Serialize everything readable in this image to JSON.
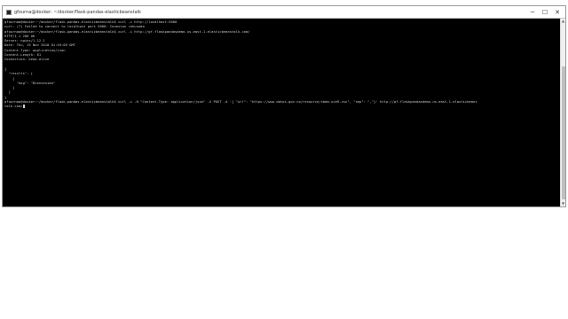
{
  "window": {
    "title": "gfourna@docker: ~/docker/flask-pandas-elasticbeanstalk",
    "controls": {
      "minimize": "─",
      "maximize": "☐",
      "close": "✕"
    }
  },
  "terminal": {
    "lines": [
      "gfournaa@docker:~/docker/flask-pandas-elasticbeanstalk$ curl -i http://localhost:5000",
      "curl: (7) Failed to connect to localhost port 5000: Conexion rehusada",
      "gfournaa@docker:~/docker/flask-pandas-elasticbeanstalk$ curl -i http://gf-flaskpandasdemo.us-east-1.elasticbeanstalk.com/",
      "HTTP/1.1 200 OK",
      "Server: nginx/1.12.1",
      "Date: Thu, 15 Nov 2018 01:49:09 GMT",
      "Content-Type: application/json",
      "Content-Length: 61",
      "Connection: keep-alive",
      "",
      "{",
      "  \"results\": [",
      "    {",
      "      \"msg\": \"Bienvenido\"",
      "    }",
      "  ]",
      "}",
      "gfournaa@docker:~/docker/flask-pandas-elasticbeanstalk$ curl -i -H \"Content-Type: application/json\" -X POST -d '{ \"url\": \"https://www.datos.gov.co/resource/cbdm-uxh9.csv\", \"sep\": \",\"}' http://gf-flaskpandasdemo.us-east-1.elasticbeans",
      "talk.com/"
    ]
  }
}
